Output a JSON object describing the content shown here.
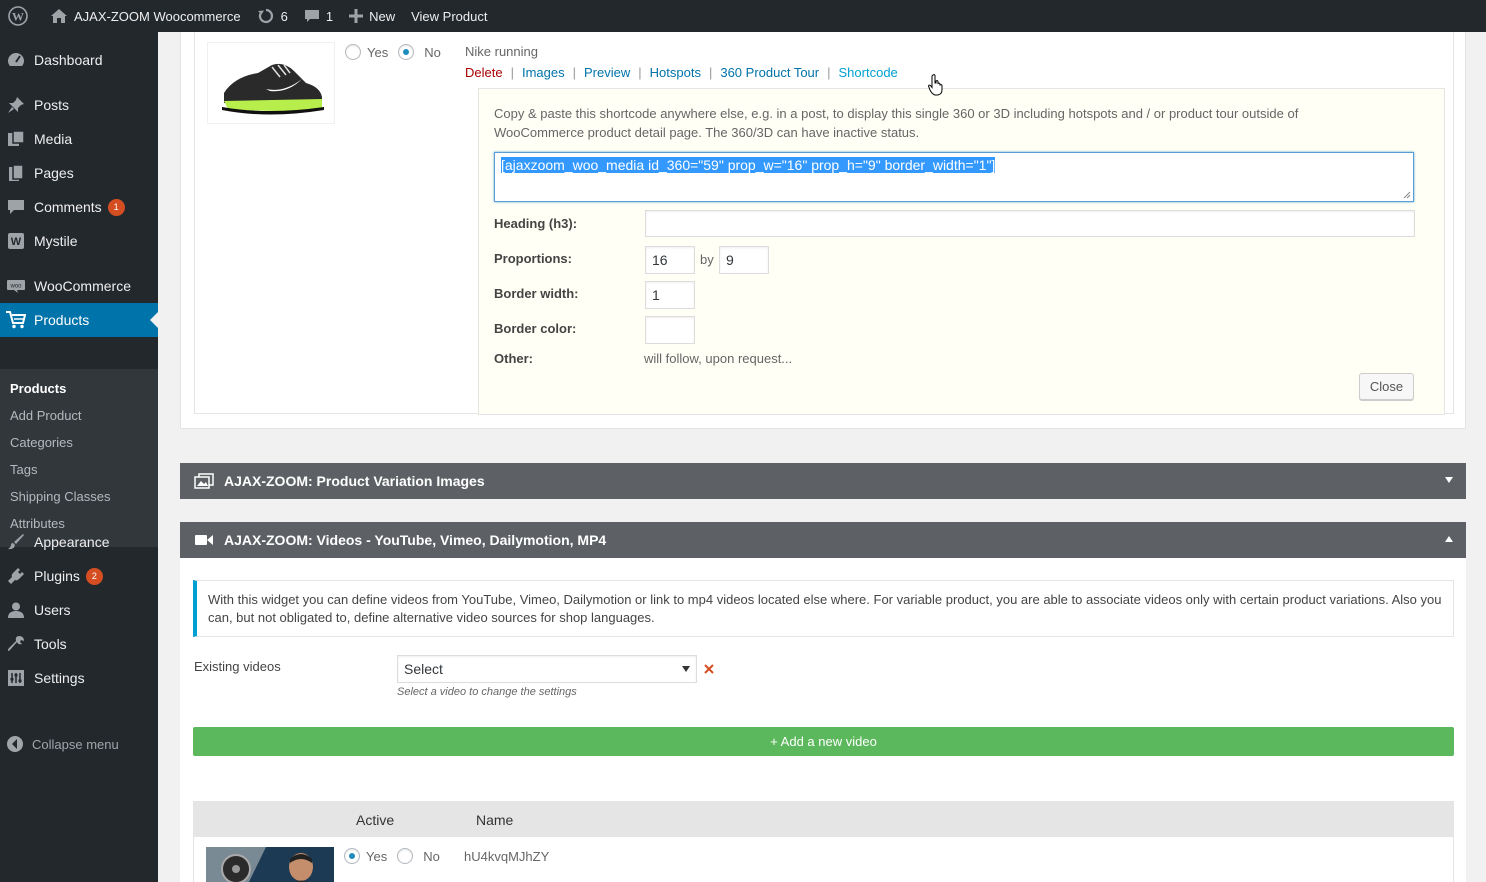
{
  "adminbar": {
    "site_name": "AJAX-ZOOM Woocommerce",
    "updates_count": "6",
    "comments_count": "1",
    "new_label": "New",
    "view_product_label": "View Product"
  },
  "sidebar": {
    "items": [
      {
        "label": "Dashboard",
        "icon": "dashboard-icon"
      },
      {
        "label": "Posts",
        "icon": "pin-icon"
      },
      {
        "label": "Media",
        "icon": "media-icon"
      },
      {
        "label": "Pages",
        "icon": "pages-icon"
      },
      {
        "label": "Comments",
        "icon": "comment-icon",
        "badge": "1"
      },
      {
        "label": "Mystile",
        "icon": "theme-icon"
      },
      {
        "label": "WooCommerce",
        "icon": "woo-icon"
      },
      {
        "label": "Products",
        "icon": "cart-icon"
      },
      {
        "label": "Appearance",
        "icon": "brush-icon"
      },
      {
        "label": "Plugins",
        "icon": "plug-icon",
        "badge": "2"
      },
      {
        "label": "Users",
        "icon": "user-icon"
      },
      {
        "label": "Tools",
        "icon": "wrench-icon"
      },
      {
        "label": "Settings",
        "icon": "settings-icon"
      }
    ],
    "submenu": [
      "Products",
      "Add Product",
      "Categories",
      "Tags",
      "Shipping Classes",
      "Attributes"
    ],
    "collapse_label": "Collapse menu"
  },
  "product360": {
    "yes_label": "Yes",
    "no_label": "No",
    "name": "Nike running",
    "actions": [
      "Delete",
      "Images",
      "Preview",
      "Hotspots",
      "360 Product Tour",
      "Shortcode"
    ],
    "shortcode_help": "Copy & paste this shortcode anywhere else, e.g. in a post, to display this single 360 or 3D including hotspots and / or product tour outside of WooCommerce product detail page. The 360/3D can have inactive status.",
    "shortcode_value": "[ajaxzoom_woo_media id_360=\"59\" prop_w=\"16\" prop_h=\"9\" border_width=\"1\"]",
    "heading_label": "Heading (h3):",
    "heading_value": "",
    "proportions_label": "Proportions:",
    "prop_w": "16",
    "by_label": "by",
    "prop_h": "9",
    "border_width_label": "Border width:",
    "border_width_value": "1",
    "border_color_label": "Border color:",
    "border_color_value": "",
    "other_label": "Other:",
    "other_value": "will follow, upon request...",
    "close_label": "Close"
  },
  "variation_box": {
    "title": "AJAX-ZOOM: Product Variation Images"
  },
  "videos_box": {
    "title": "AJAX-ZOOM: Videos - YouTube, Vimeo, Dailymotion, MP4",
    "notice": "With this widget you can define videos from YouTube, Vimeo, Dailymotion or link to mp4 videos located else where. For variable product, you are able to associate videos only with certain product variations. Also you can, but not obligated to, define alternative video sources for shop languages.",
    "existing_label": "Existing videos",
    "select_value": "Select",
    "select_hint": "Select a video to change the settings",
    "add_button": "+ Add a new video",
    "table_headers": [
      "Active",
      "Name"
    ],
    "rows": [
      {
        "yes_label": "Yes",
        "no_label": "No",
        "name": "hU4kvqMJhZY"
      }
    ]
  },
  "colors": {
    "admin_dark": "#23282d",
    "active_blue": "#0073aa",
    "badge_orange": "#d54e21",
    "green_button": "#5cb85c",
    "box_header": "#5d6165"
  }
}
